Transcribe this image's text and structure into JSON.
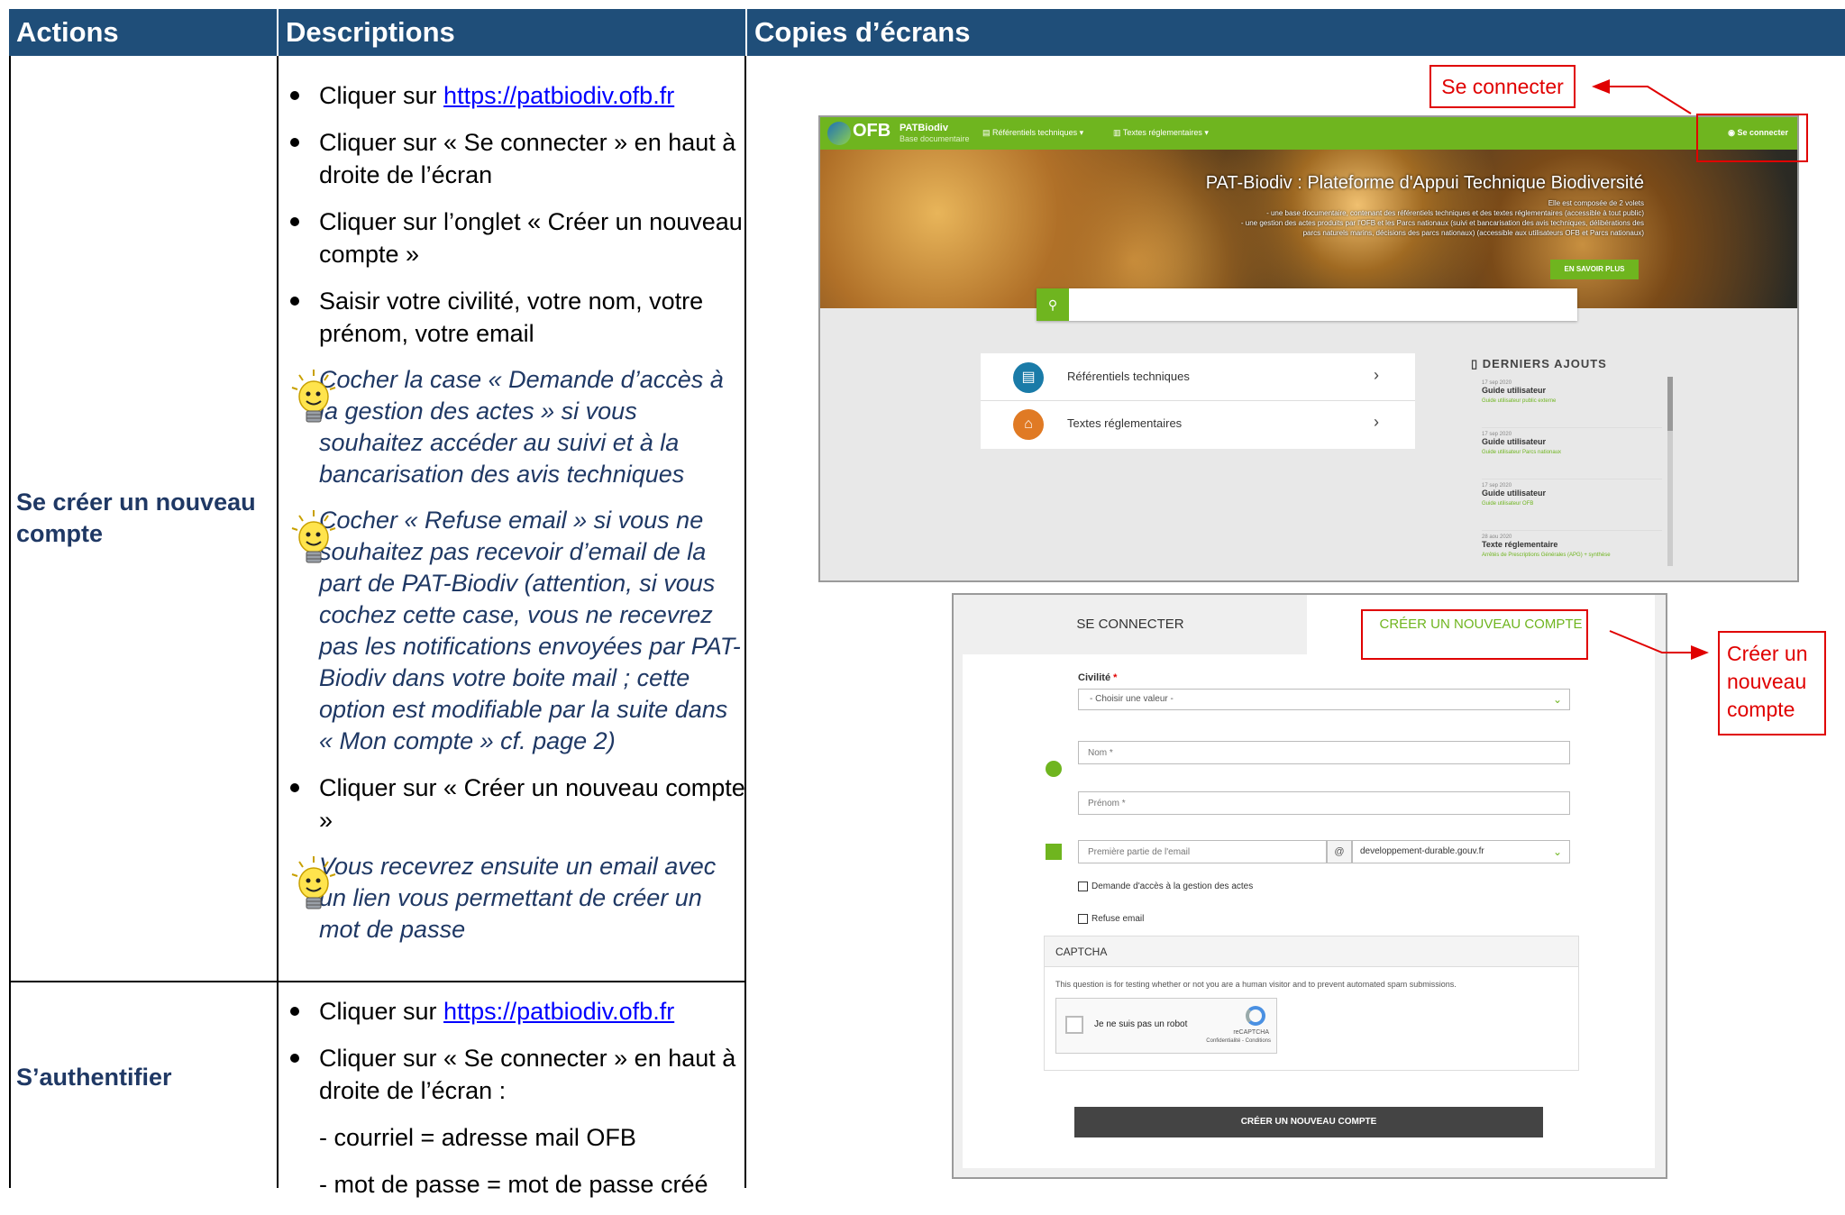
{
  "headers": {
    "actions": "Actions",
    "descriptions": "Descriptions",
    "screens": "Copies d’écrans"
  },
  "rows": [
    {
      "action": "Se créer un nouveau compte",
      "steps": {
        "s1_prefix": "Cliquer sur ",
        "s1_link": "https://patbiodiv.ofb.fr",
        "s2": "Cliquer sur « Se connecter » en haut à droite de l’écran",
        "s3": "Cliquer sur l’onglet « Créer un nouveau compte »",
        "s4": "Saisir votre civilité, votre nom, votre prénom, votre email",
        "tip1": "Cocher la case « Demande d’accès à la gestion des actes » si vous souhaitez accéder au suivi et à la bancarisation des avis techniques",
        "tip2": "Cocher « Refuse email » si vous ne souhaitez pas recevoir d’email de la part de PAT-Biodiv (attention, si vous cochez cette case, vous ne recevrez pas les notifications envoyées par PAT-Biodiv dans votre boite mail ; cette option est modifiable par la suite dans « Mon compte » cf. page 2)",
        "s5": "Cliquer sur « Créer un nouveau compte »",
        "tip3": "Vous recevrez ensuite un email avec un lien vous permettant de créer un mot de passe"
      }
    },
    {
      "action": "S’authentifier",
      "steps": {
        "s1_prefix": "Cliquer sur ",
        "s1_link": "https://patbiodiv.ofb.fr",
        "s2": "Cliquer sur « Se connecter » en haut à droite de l’écran :",
        "sub1": "- courriel = adresse mail OFB",
        "sub2": "- mot de passe = mot de passe créé"
      }
    }
  ],
  "callouts": {
    "connect": "Se connecter",
    "create": "Créer un nouveau compte"
  },
  "site": {
    "logo": "OFB",
    "brand": "PATBiodiv",
    "brand_sub": "Base documentaire",
    "nav1": "Référentiels techniques",
    "nav2": "Textes réglementaires",
    "login": "Se connecter",
    "hero_title": "PAT-Biodiv : Plateforme d'Appui Technique Biodiversité",
    "hero_l1": "Elle est composée de 2 volets",
    "hero_l2": "- une base documentaire, contenant des référentiels techniques et des textes réglementaires (accessible à tout public)",
    "hero_l3": "- une gestion des actes produits par l'OFB et les Parcs nationaux (suivi et bancarisation des avis techniques, délibérations des",
    "hero_l4": "parcs naturels marins, décisions des parcs nationaux) (accessible aux utilisateurs OFB et Parcs nationaux)",
    "hero_btn": "EN SAVOIR PLUS",
    "card1": "Référentiels techniques",
    "card2": "Textes réglementaires",
    "latest_title": "DERNIERS AJOUTS",
    "latest": [
      {
        "date": "17 sep 2020",
        "title": "Guide utilisateur",
        "sub": "Guide utilisateur public externe"
      },
      {
        "date": "17 sep 2020",
        "title": "Guide utilisateur",
        "sub": "Guide utilisateur Parcs nationaux"
      },
      {
        "date": "17 sep 2020",
        "title": "Guide utilisateur",
        "sub": "Guide utilisateur OFB"
      },
      {
        "date": "28 aou 2020",
        "title": "Texte réglementaire",
        "sub": "Arrêtés de Prescriptions Générales (APG) + synthèse"
      }
    ]
  },
  "form": {
    "tab_login": "SE CONNECTER",
    "tab_create": "CRÉER UN NOUVEAU COMPTE",
    "civ_label": "Civilité",
    "civ_req": "*",
    "civ_value": "- Choisir une valeur -",
    "nom_ph": "Nom *",
    "prenom_ph": "Prénom *",
    "email_ph": "Première partie de l'email",
    "at": "@",
    "domain": "developpement-durable.gouv.fr",
    "cb1": "Demande d'accès à la gestion des actes",
    "cb2": "Refuse email",
    "captcha_title": "CAPTCHA",
    "captcha_text": "This question is for testing whether or not you are a human visitor and to prevent automated spam submissions.",
    "robot": "Je ne suis pas un robot",
    "recaptcha": "reCAPTCHA",
    "recaptcha_links": "Confidentialité - Conditions",
    "submit": "CRÉER UN NOUVEAU COMPTE"
  },
  "colors": {
    "header": "#1f4e79",
    "action_text": "#1f3864",
    "site_green": "#6fb51f",
    "callout_red": "#e00000"
  }
}
